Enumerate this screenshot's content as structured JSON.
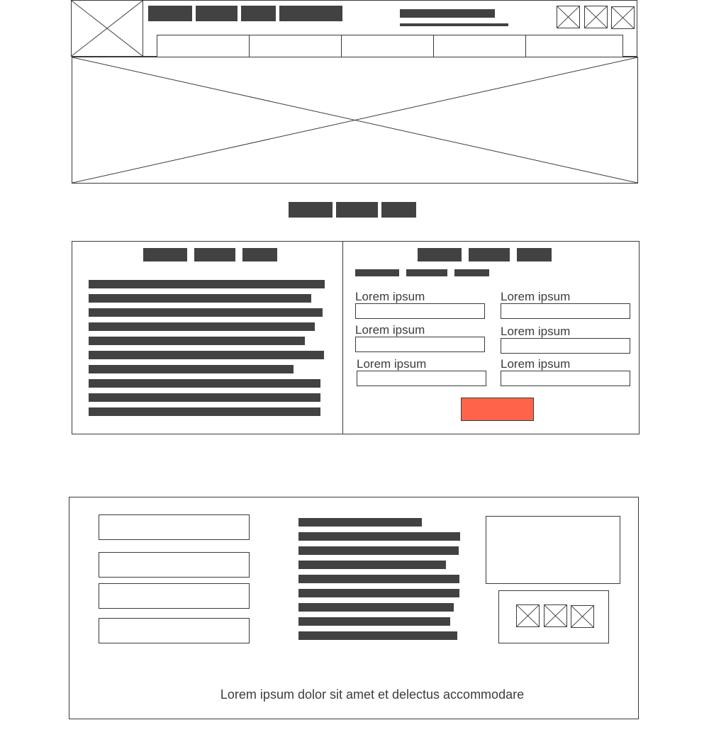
{
  "colors": {
    "stroke": "#3a3a3a",
    "placeholder_bar": "#424242",
    "accent_button": "#ff644b",
    "text": "#3c3c3c"
  },
  "header": {
    "logo_icon": "image-placeholder-icon",
    "utility_icons": [
      "image-placeholder-icon",
      "image-placeholder-icon",
      "image-placeholder-icon"
    ],
    "nav_tab_count": 5
  },
  "hero": {
    "icon": "image-placeholder-icon"
  },
  "contact_form": {
    "fields": [
      {
        "label": "Lorem ipsum"
      },
      {
        "label": "Lorem ipsum"
      },
      {
        "label": "Lorem ipsum"
      },
      {
        "label": "Lorem ipsum"
      },
      {
        "label": "Lorem ipsum"
      },
      {
        "label": "Lorem ipsum"
      }
    ]
  },
  "footer": {
    "social_icons": [
      "image-placeholder-icon",
      "image-placeholder-icon",
      "image-placeholder-icon"
    ],
    "caption": "Lorem ipsum dolor sit amet et delectus accommodare"
  }
}
